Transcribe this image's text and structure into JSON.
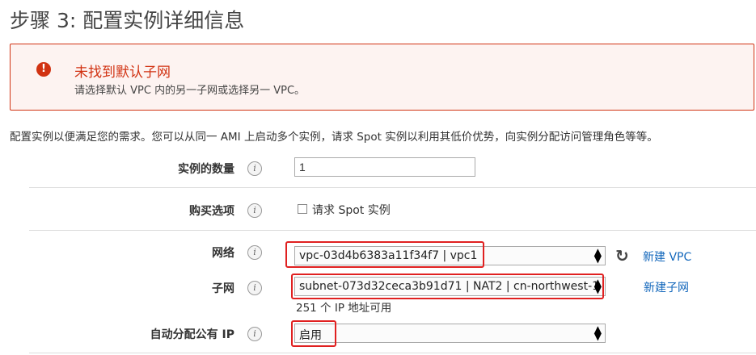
{
  "page": {
    "title": "步骤 3: 配置实例详细信息"
  },
  "alert": {
    "title": "未找到默认子网",
    "message": "请选择默认 VPC 内的另一子网或选择另一 VPC。",
    "icon": "error-icon",
    "color": "#d13212"
  },
  "intro": "配置实例以便满足您的需求。您可以从同一 AMI 上启动多个实例，请求 Spot 实例以利用其低价优势，向实例分配访问管理角色等等。",
  "form": {
    "instance_count": {
      "label": "实例的数量",
      "value": "1"
    },
    "purchase": {
      "label": "购买选项",
      "checkbox_label": "请求 Spot 实例",
      "checked": false
    },
    "network": {
      "label": "网络",
      "selected": "vpc-03d4b6383a11f34f7 | vpc1",
      "new_link": "新建 VPC"
    },
    "subnet": {
      "label": "子网",
      "selected": "subnet-073d32ceca3b91d71 | NAT2 | cn-northwest-1",
      "new_link": "新建子网",
      "helper": "251 个 IP 地址可用"
    },
    "public_ip": {
      "label": "自动分配公有 IP",
      "selected": "启用"
    }
  },
  "colors": {
    "highlight": "#e02020",
    "link": "#1166bb",
    "error": "#d13212"
  }
}
